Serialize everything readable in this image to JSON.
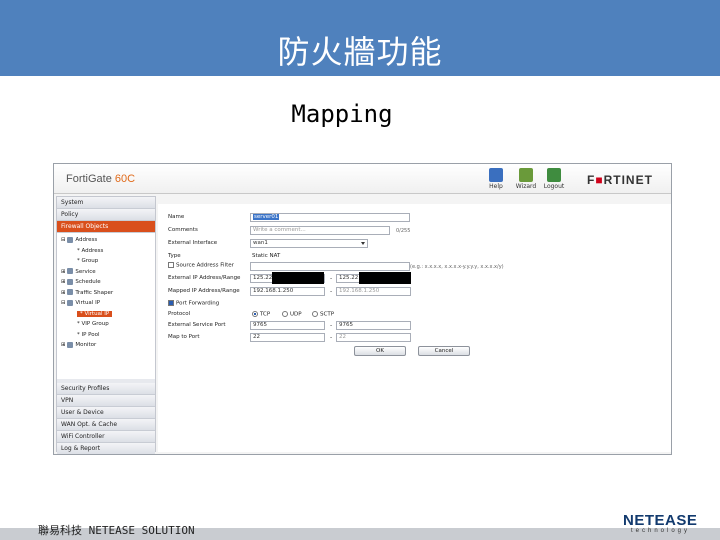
{
  "slide": {
    "title": "防火牆功能",
    "subtitle": "Mapping",
    "footer": "聯易科技  NETEASE SOLUTION",
    "logo_main": "NETEASE",
    "logo_sub": "technology",
    "header_color": "#4f81bd"
  },
  "app": {
    "device": "FortiGate",
    "model": "60C",
    "brand_prefix": "F",
    "brand_rest": "RTINET",
    "top_buttons": [
      {
        "label": "Help",
        "icon": "help-icon"
      },
      {
        "label": "Wizard",
        "icon": "wizard-icon"
      },
      {
        "label": "Logout",
        "icon": "logout-icon"
      }
    ]
  },
  "sidebar": {
    "top": [
      "System",
      "Policy",
      "Firewall Objects"
    ],
    "tree": [
      {
        "label": "Address",
        "prefix": "⊟",
        "icon": true
      },
      {
        "label": "* Address",
        "prefix": "",
        "icon": false
      },
      {
        "label": "* Group",
        "prefix": "",
        "icon": false
      },
      {
        "label": "Service",
        "prefix": "⊞",
        "icon": true
      },
      {
        "label": "Schedule",
        "prefix": "⊞",
        "icon": true
      },
      {
        "label": "Traffic Shaper",
        "prefix": "⊞",
        "icon": true
      },
      {
        "label": "Virtual IP",
        "prefix": "⊟",
        "icon": true
      },
      {
        "label": "* Virtual IP",
        "prefix": "",
        "icon": false,
        "selected": true
      },
      {
        "label": "* VIP Group",
        "prefix": "",
        "icon": false
      },
      {
        "label": "* IP Pool",
        "prefix": "",
        "icon": false
      },
      {
        "label": "Monitor",
        "prefix": "⊞",
        "icon": true
      }
    ],
    "bottom": [
      "Security Profiles",
      "VPN",
      "User & Device",
      "WAN Opt. & Cache",
      "WiFi Controller",
      "Log & Report"
    ]
  },
  "form": {
    "name_label": "Name",
    "name_value": "server01",
    "comments_label": "Comments",
    "comments_placeholder": "Write a comment...",
    "comments_count": "0/255",
    "ext_iface_label": "External Interface",
    "ext_iface_value": "wan1",
    "type_label": "Type",
    "type_value": "Static NAT",
    "src_filter_label": "Source Address Filter",
    "src_filter_hint": "(e.g.: x.x.x.x, x.x.x.x-y.y.y.y, x.x.x.x/y)",
    "ext_ip_label": "External IP Address/Range",
    "ext_ip_from": "125.22",
    "ext_ip_to": "125.22",
    "mapped_ip_label": "Mapped IP Address/Range",
    "mapped_ip_from": "192.168.1.250",
    "mapped_ip_to": "192.168.1.250",
    "port_fwd_label": "Port Forwarding",
    "protocol_label": "Protocol",
    "protocols": [
      "TCP",
      "UDP",
      "SCTP"
    ],
    "ext_port_label": "External Service Port",
    "ext_port_from": "9765",
    "ext_port_to": "9765",
    "map_port_label": "Map to Port",
    "map_port_from": "22",
    "map_port_to": "22",
    "ok": "OK",
    "cancel": "Cancel",
    "range_sep": "-"
  }
}
